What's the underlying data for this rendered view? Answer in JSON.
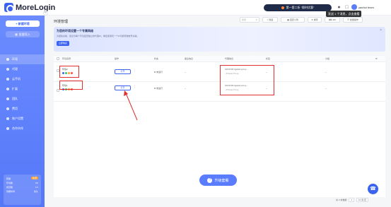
{
  "app": {
    "name": "MoreLogin"
  },
  "page": {
    "title": "环境管理"
  },
  "topbar": {
    "promo_text": "第一套二折 “限时优惠”",
    "tooltip": "发送 1 个消息，点击查看",
    "user_name": "yaohui team"
  },
  "sidebar": {
    "new_env_label": "+ 新建环境",
    "bulk_import_label": "批量导入",
    "collapse_icon": "«",
    "items": [
      {
        "label": "环境",
        "icon": "browser-icon",
        "active": true
      },
      {
        "label": "代理",
        "icon": "proxy-icon"
      },
      {
        "label": "云手机",
        "icon": "cloud-phone-icon"
      },
      {
        "label": "扩展",
        "icon": "extension-icon"
      },
      {
        "label": "团队",
        "icon": "team-icon"
      },
      {
        "label": "费用",
        "icon": "billing-icon"
      },
      {
        "label": "账户设置",
        "icon": "settings-icon"
      },
      {
        "label": "合作伙伴",
        "icon": "partner-icon"
      }
    ],
    "plan": {
      "title": "套餐",
      "badge": "免费",
      "rows": [
        {
          "label": "环境数",
          "value": "2/2"
        },
        {
          "label": "成员数",
          "value": "1/1"
        },
        {
          "label": "到期时间",
          "value": "永久"
        }
      ]
    }
  },
  "toolbar": {
    "search_placeholder": "搜索",
    "filter_label": "筛选",
    "custom_columns_label": "自定义列",
    "sort_label": "排序",
    "api_label": "API",
    "batch_label": "批量操作"
  },
  "banner": {
    "title": "为您的环境设置一个专属网络",
    "subtitle": "为避免关联，建议为每个环境配置独立的代理IP。重复使用同一个IP可能导致帐号关联。",
    "button_label": "立即购买",
    "close_icon": "×"
  },
  "table": {
    "headers": [
      "环境名称",
      "操作",
      "状态",
      "备注信息",
      "代理信息",
      "标签",
      "分组"
    ],
    "rows": [
      {
        "name": "环境2",
        "open_label": "打开",
        "status": "未运行",
        "remark": "--",
        "proxy": "SOCKS5://gate2.proxy...",
        "proxy_sub": "--Private Proxy",
        "tag": "--",
        "group": "--",
        "dot_colors": [
          "#3b63f0",
          "#34c759",
          "#ff9f2e",
          "#ff4d4f"
        ]
      },
      {
        "name": "环境1",
        "open_label": "打开",
        "status": "未运行",
        "remark": "--",
        "proxy": "SOCKS5://gate2.proxy...",
        "proxy_sub": "--Private Proxy",
        "tag": "--",
        "group": "--",
        "dot_colors": [
          "#3b63f0",
          "#34c759",
          "#ff9f2e",
          "#ff4d4f"
        ]
      }
    ]
  },
  "upgrade": {
    "label": "升级套餐",
    "icon": "?"
  },
  "support": {
    "icon": "headset-icon"
  },
  "footer": {
    "total": "共 2 条数据",
    "page_size": "10 条/页",
    "page": "1"
  },
  "colors": {
    "accent": "#3b63f0",
    "annotation": "#e0302e"
  }
}
